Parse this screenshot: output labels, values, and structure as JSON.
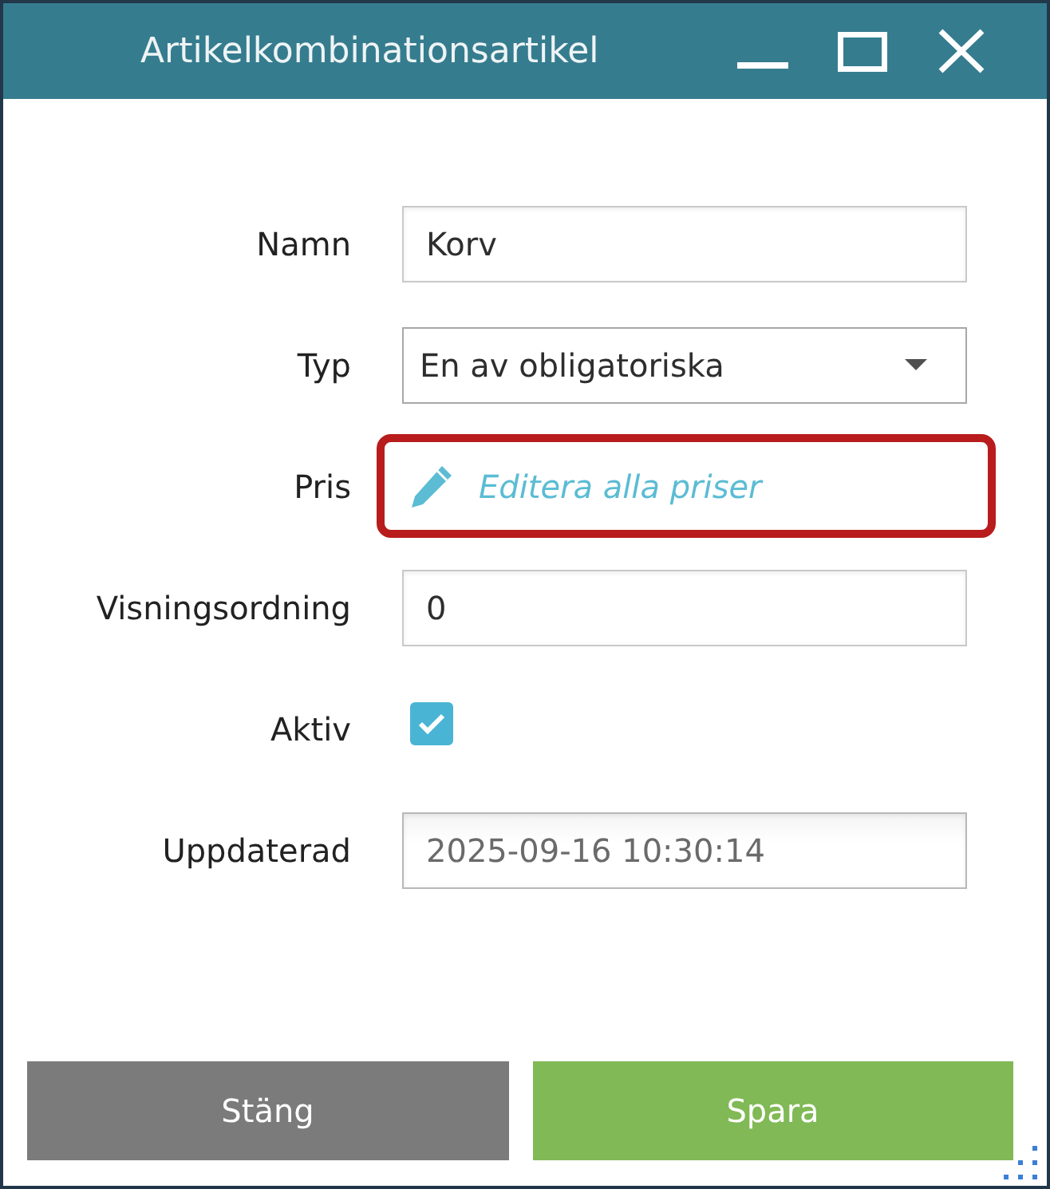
{
  "window": {
    "title": "Artikelkombinationsartikel"
  },
  "fields": [
    {
      "kind": "text",
      "label": "Namn",
      "value": "Korv",
      "disabled": false,
      "highlighted": false
    },
    {
      "kind": "dropdown",
      "label": "Typ",
      "value": "En av obligatoriska",
      "disabled": false,
      "highlighted": false
    },
    {
      "kind": "link",
      "label": "Pris",
      "link": "Editera alla priser",
      "disabled": false,
      "highlighted": true
    },
    {
      "kind": "text",
      "label": "Visningsordning",
      "value": "0",
      "disabled": false,
      "highlighted": false
    },
    {
      "kind": "checkbox",
      "label": "Aktiv",
      "checked": true,
      "disabled": false,
      "highlighted": false
    },
    {
      "kind": "text",
      "label": "Uppdaterad",
      "value": "2025-09-16 10:30:14",
      "disabled": true,
      "highlighted": false
    }
  ],
  "buttons": [
    {
      "kind": "secondary",
      "label": "Stäng"
    },
    {
      "kind": "primary",
      "label": "Spara"
    }
  ]
}
